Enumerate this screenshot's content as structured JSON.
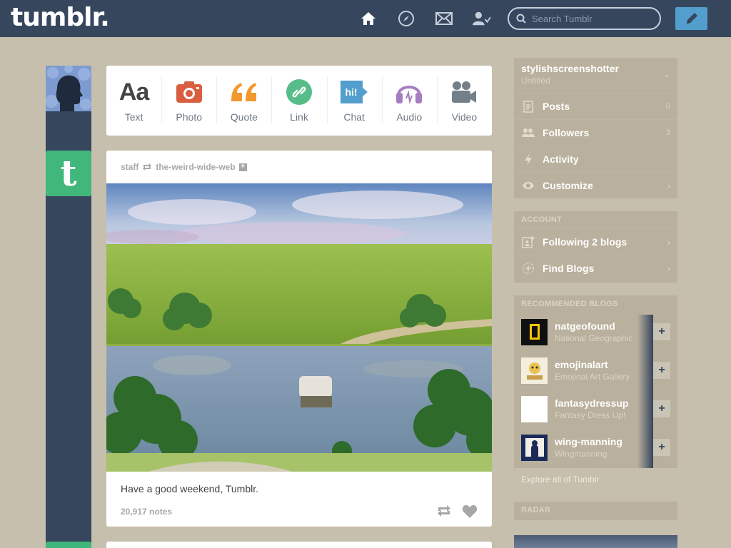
{
  "header": {
    "logo": "tumblr.",
    "search_placeholder": "Search Tumblr",
    "icons": [
      "home-icon",
      "explore-icon",
      "inbox-icon",
      "account-icon",
      "compose-icon"
    ]
  },
  "post_types": [
    {
      "label": "Text",
      "icon": "text-icon",
      "color": "#444444"
    },
    {
      "label": "Photo",
      "icon": "camera-icon",
      "color": "#d95e40"
    },
    {
      "label": "Quote",
      "icon": "quote-icon",
      "color": "#f2992e"
    },
    {
      "label": "Link",
      "icon": "link-icon",
      "color": "#56bc8a"
    },
    {
      "label": "Chat",
      "icon": "chat-icon",
      "color": "#529ecc"
    },
    {
      "label": "Audio",
      "icon": "headphones-icon",
      "color": "#a77dc2"
    },
    {
      "label": "Video",
      "icon": "video-camera-icon",
      "color": "#748089"
    }
  ],
  "post": {
    "author": "staff",
    "reblogged_from": "the-weird-wide-web",
    "caption": "Have a good weekend, Tumblr.",
    "notes": "20,917 notes"
  },
  "sidebar": {
    "blog": {
      "name": "stylishscreenshotter",
      "subtitle": "Untitled"
    },
    "blog_items": [
      {
        "label": "Posts",
        "icon": "posts-icon",
        "count": "0"
      },
      {
        "label": "Followers",
        "icon": "followers-icon",
        "count": "3"
      },
      {
        "label": "Activity",
        "icon": "lightning-icon",
        "count": ""
      },
      {
        "label": "Customize",
        "icon": "eye-icon",
        "count": "›"
      }
    ],
    "account_title": "ACCOUNT",
    "account_items": [
      {
        "label": "Following 2 blogs",
        "icon": "following-icon"
      },
      {
        "label": "Find Blogs",
        "icon": "find-blogs-icon"
      }
    ],
    "recommended_title": "RECOMMENDED BLOGS",
    "recommended": [
      {
        "name": "natgeofound",
        "subtitle": "National Geographic"
      },
      {
        "name": "emojinalart",
        "subtitle": "Emojinal Art Gallery"
      },
      {
        "name": "fantasydressup",
        "subtitle": "Fantasy Dress Up!"
      },
      {
        "name": "wing-manning",
        "subtitle": "Wingmanning"
      }
    ],
    "explore": "Explore all of Tumblr",
    "radar_title": "RADAR"
  }
}
